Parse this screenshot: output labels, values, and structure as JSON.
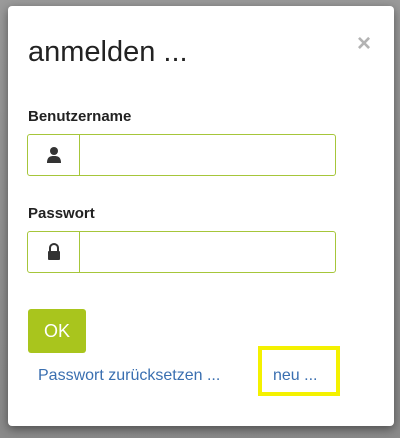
{
  "dialog": {
    "title": "anmelden ...",
    "close_icon": "close-icon"
  },
  "username": {
    "label": "Benutzername",
    "value": "",
    "icon": "user-icon"
  },
  "password": {
    "label": "Passwort",
    "value": "",
    "icon": "lock-icon"
  },
  "actions": {
    "ok_label": "OK",
    "reset_link": "Passwort zurücksetzen ...",
    "new_link": "neu ..."
  },
  "colors": {
    "accent": "#a9c51d",
    "link": "#3a6fb0",
    "highlight": "#f4f100"
  }
}
